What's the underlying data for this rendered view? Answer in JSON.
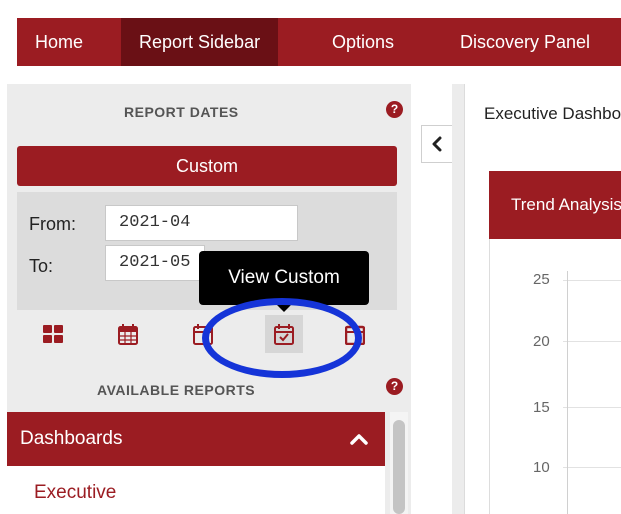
{
  "nav": {
    "items": [
      {
        "label": "Home",
        "active": false
      },
      {
        "label": "Report Sidebar",
        "active": true
      },
      {
        "label": "Options",
        "active": false
      },
      {
        "label": "Discovery Panel",
        "active": false
      }
    ]
  },
  "sidebar": {
    "report_dates": {
      "title": "REPORT DATES",
      "help": "?",
      "range_button": "Custom",
      "from_label": "From:",
      "from_value": "2021-04",
      "to_label": "To:",
      "to_value": "2021-05"
    },
    "date_icons": [
      "grid-icon",
      "calendar-month-icon",
      "calendar-plus-icon",
      "calendar-check-icon",
      "calendar-icon"
    ],
    "tooltip": "View Custom",
    "available_reports": {
      "title": "AVAILABLE REPORTS",
      "help": "?",
      "group_label": "Dashboards",
      "items": [
        "Executive"
      ]
    }
  },
  "main": {
    "title": "Executive Dashboard",
    "card_title": "Trend Analysis",
    "y_ticks": [
      "25",
      "20",
      "15",
      "10"
    ]
  },
  "colors": {
    "brand": "#9b1c22",
    "brand_dark": "#6a1015",
    "annotation": "#1534d8"
  }
}
